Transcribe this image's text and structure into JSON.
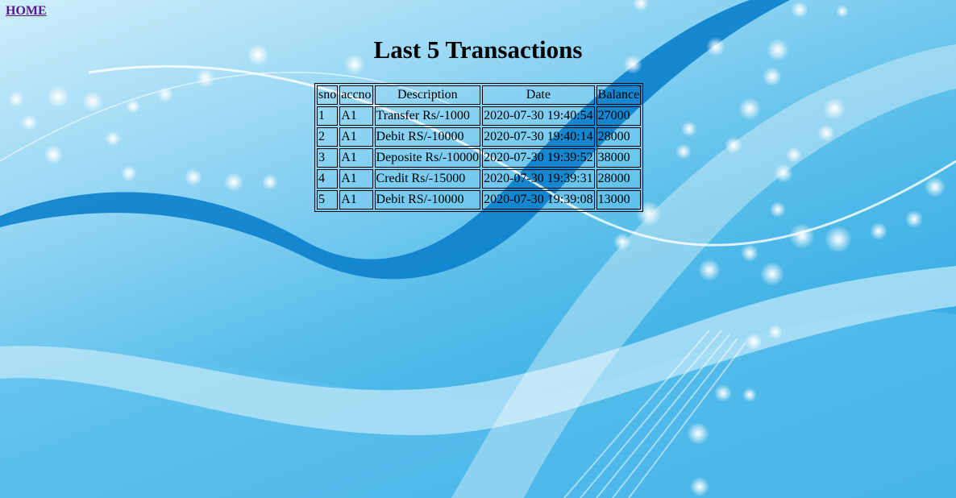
{
  "nav": {
    "home_label": "HOME"
  },
  "page": {
    "title": "Last 5 Transactions"
  },
  "table": {
    "headers": [
      "sno",
      "accno",
      "Description",
      "Date",
      "Balance"
    ],
    "rows": [
      [
        "1",
        "A1",
        "Transfer Rs/-1000",
        "2020-07-30 19:40:54",
        "27000"
      ],
      [
        "2",
        "A1",
        "Debit RS/-10000",
        "2020-07-30 19:40:14",
        "28000"
      ],
      [
        "3",
        "A1",
        "Deposite Rs/-10000",
        "2020-07-30 19:39:52",
        "38000"
      ],
      [
        "4",
        "A1",
        "Credit Rs/-15000",
        "2020-07-30 19:39:31",
        "28000"
      ],
      [
        "5",
        "A1",
        "Debit RS/-10000",
        "2020-07-30 19:39:08",
        "13000"
      ]
    ]
  },
  "colors": {
    "link_visited": "#551a8b",
    "background_light": "#cfeefb",
    "background_mid": "#56bde9",
    "background_dark": "#2aa6df",
    "wave_dark": "#0a7fcc"
  }
}
